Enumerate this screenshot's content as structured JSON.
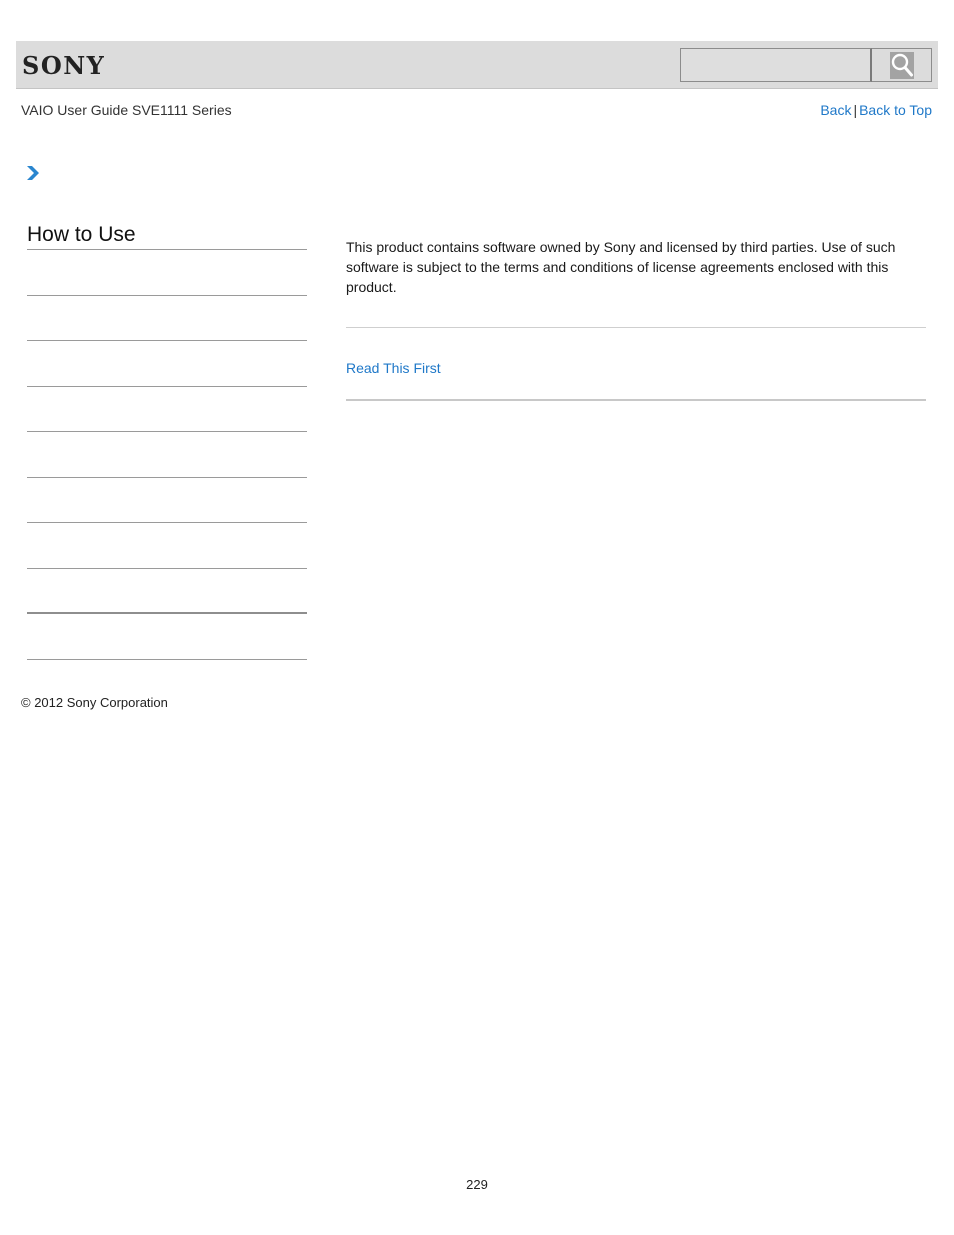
{
  "header": {
    "logo_text": "SONY",
    "search": {
      "placeholder": "",
      "value": "",
      "button_icon": "search-icon"
    }
  },
  "guide_title": "VAIO User Guide SVE1111 Series",
  "top_links": {
    "back": "Back",
    "separator": "|",
    "back_to_top": "Back to Top"
  },
  "breadcrumb": {
    "icon": "chevron-right-icon",
    "accent_color": "#1f78c8"
  },
  "sidebar": {
    "title": "How to Use",
    "items": [
      {
        "label": ""
      },
      {
        "label": ""
      },
      {
        "label": ""
      },
      {
        "label": ""
      },
      {
        "label": ""
      },
      {
        "label": ""
      },
      {
        "label": ""
      },
      {
        "label": ""
      },
      {
        "label": ""
      }
    ]
  },
  "content": {
    "body": "This product contains software owned by Sony and licensed by third parties. Use of such software is subject to the terms and conditions of license agreements enclosed with this product.",
    "related_link": "Read This First"
  },
  "footer": {
    "copyright": "© 2012 Sony Corporation",
    "page_number": "229"
  }
}
